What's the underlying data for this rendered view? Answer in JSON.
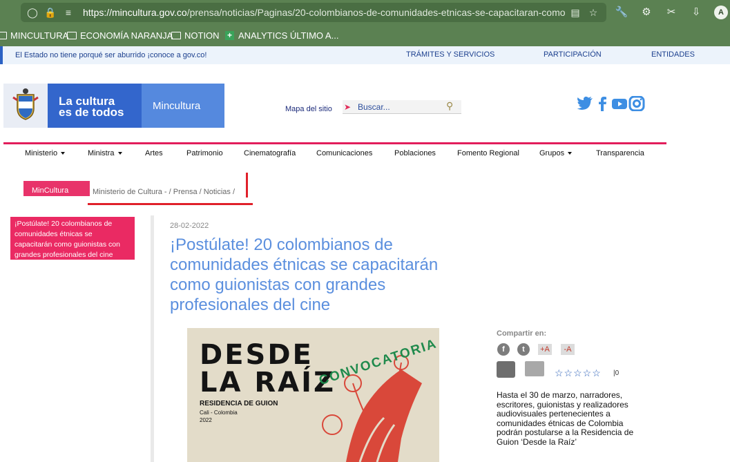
{
  "browser": {
    "url_host": "https://mincultura.gov.co",
    "url_path": "/prensa/noticias/Paginas/20-colombianos-de-comunidades-etnicas-se-capacitaran-como",
    "avatar_letter": "A",
    "bookmarks": [
      {
        "label": "MINCULTURA",
        "icon": "folder-icon"
      },
      {
        "label": "ECONOMÍA NARANJA",
        "icon": "folder-icon"
      },
      {
        "label": "NOTION",
        "icon": "folder-icon"
      },
      {
        "label": "ANALYTICS ÚLTIMO A...",
        "icon": "plus-icon"
      }
    ]
  },
  "govbar": {
    "message": "El Estado no tiene porqué ser aburrido ¡conoce a gov.co!",
    "links": [
      "TRÁMITES Y SERVICIOS",
      "PARTICIPACIÓN",
      "ENTIDADES"
    ]
  },
  "header": {
    "slogan": "La cultura\nes de todos",
    "brand": "Mincultura",
    "site_map": "Mapa del sitio",
    "search_placeholder": "Buscar...",
    "social": [
      "twitter-icon",
      "facebook-icon",
      "youtube-icon",
      "instagram-icon"
    ]
  },
  "nav": [
    {
      "label": "Ministerio",
      "dropdown": true
    },
    {
      "label": "Ministra",
      "dropdown": true
    },
    {
      "label": "Artes",
      "dropdown": false
    },
    {
      "label": "Patrimonio",
      "dropdown": false
    },
    {
      "label": "Cinematografía",
      "dropdown": false
    },
    {
      "label": "Comunicaciones",
      "dropdown": false
    },
    {
      "label": "Poblaciones",
      "dropdown": false
    },
    {
      "label": "Fomento Regional",
      "dropdown": false
    },
    {
      "label": "Grupos",
      "dropdown": true
    },
    {
      "label": "Transparencia",
      "dropdown": false
    }
  ],
  "breadcrumb": {
    "tag": "MinCultura",
    "path": "Ministerio de Cultura -  /  Prensa  /  Noticias  /"
  },
  "sidebar": {
    "current": "¡Postúlate! 20 colombianos de comunidades étnicas se capacitarán como guionistas con grandes profesionales del cine"
  },
  "article": {
    "date": "28-02-2022",
    "title": "¡Postúlate! 20 colombianos de comunidades étnicas se capacitarán como guionistas con grandes profesionales del cine",
    "poster": {
      "line1": "DESDE",
      "line2": "LA RAÍZ",
      "sub1": "RESIDENCIA DE GUION",
      "sub2": "Cali - Colombia",
      "sub3": "2022",
      "arc": "CONVOCATORIA ABIE"
    },
    "share": {
      "title": "Compartir en:",
      "font_plus": "+A",
      "font_minus": "-A",
      "rating_count": "0"
    },
    "lead": "Hasta el 30 de marzo, narradores, escritores, guionistas y realizadores audiovisuales pertenecientes a comunidades étnicas de Colombia podrán postularse a la Residencia de Guion ‘Desde la Raíz’"
  }
}
